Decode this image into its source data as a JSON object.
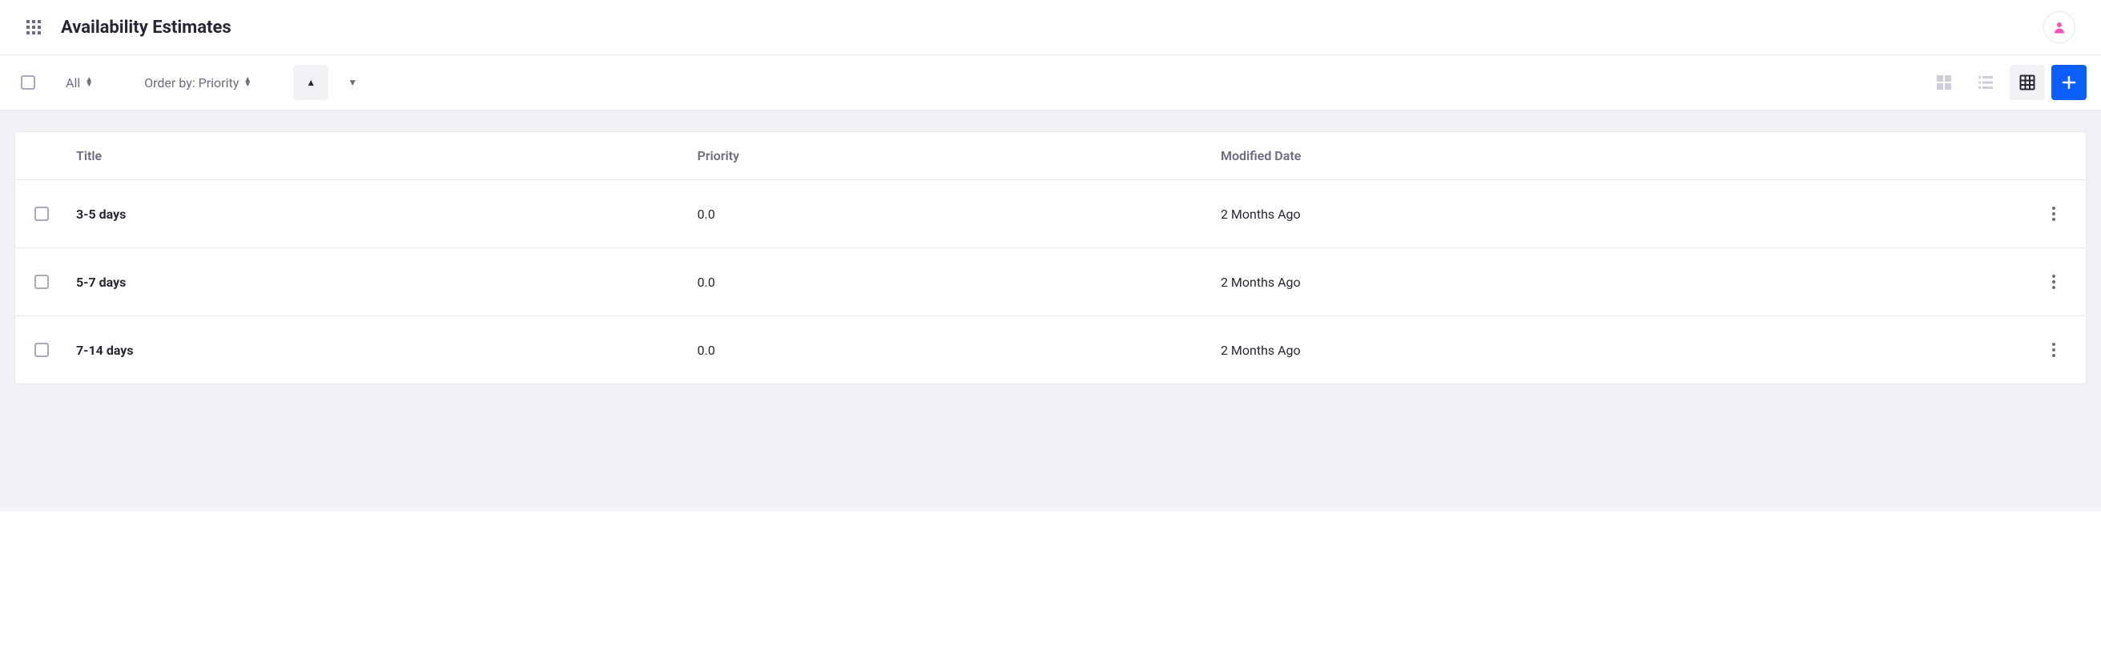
{
  "header": {
    "title": "Availability Estimates"
  },
  "toolbar": {
    "filter_label": "All",
    "order_label": "Order by: Priority"
  },
  "table": {
    "columns": {
      "title": "Title",
      "priority": "Priority",
      "modified": "Modified Date"
    },
    "rows": [
      {
        "title": "3-5 days",
        "priority": "0.0",
        "modified": "2 Months Ago"
      },
      {
        "title": "5-7 days",
        "priority": "0.0",
        "modified": "2 Months Ago"
      },
      {
        "title": "7-14 days",
        "priority": "0.0",
        "modified": "2 Months Ago"
      }
    ]
  }
}
